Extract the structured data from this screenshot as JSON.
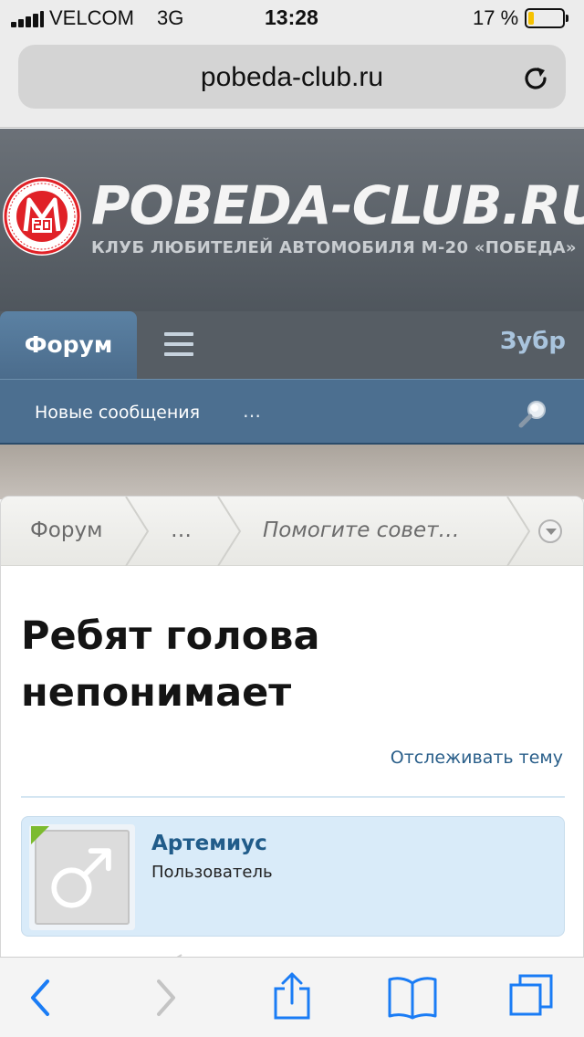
{
  "status_bar": {
    "carrier": "VELCOM",
    "network": "3G",
    "time": "13:28",
    "battery_percent": "17 %",
    "battery_level": 0.17,
    "battery_color": "#f6c200"
  },
  "browser": {
    "url": "pobeda-club.ru",
    "reload_icon": "reload-icon"
  },
  "site": {
    "title": "POBEDA-CLUB.RU",
    "subtitle": "КЛУБ ЛЮБИТЕЛЕЙ АВТОМОБИЛЯ М-20 «ПОБЕДА»",
    "logo_icon": "club-emblem-icon",
    "brand_color": "#e02127"
  },
  "nav": {
    "active_tab": "Форум",
    "menu_icon": "hamburger-icon",
    "user": "Зубр"
  },
  "subnav": {
    "new_posts": "Новые сообщения",
    "more": "…",
    "search_icon": "search-icon"
  },
  "breadcrumb": {
    "items": [
      "Форум",
      "…",
      "Помогите совет…"
    ],
    "dropdown_icon": "chevron-down-icon"
  },
  "thread": {
    "title_line1": "Ребят голова",
    "title_line2": "непонимает",
    "watch_label": "Отслеживать тему"
  },
  "post": {
    "username": "Артемиус",
    "user_title": "Пользователь",
    "avatar_icon": "male-symbol-icon",
    "online_color": "#7cbb2f"
  },
  "toolbar": {
    "back_icon": "back-arrow-icon",
    "forward_icon": "forward-arrow-icon",
    "share_icon": "share-icon",
    "bookmarks_icon": "bookmarks-icon",
    "tabs_icon": "tabs-icon"
  }
}
